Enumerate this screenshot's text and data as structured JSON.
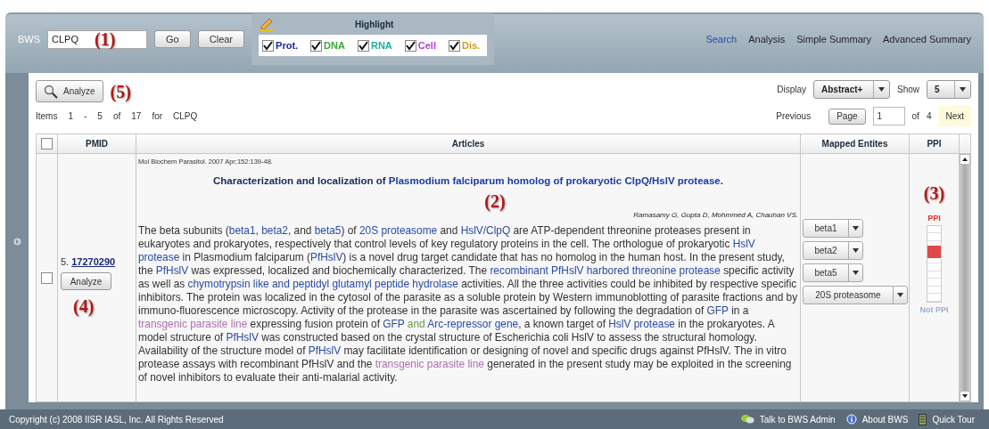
{
  "search": {
    "label": "BWS",
    "value": "CLPQ",
    "callout": "(1)",
    "go": "Go",
    "clear": "Clear"
  },
  "highlight": {
    "title": "Highlight",
    "options": [
      {
        "label": "Prot.",
        "checked": true,
        "color": "#1a2a9a"
      },
      {
        "label": "DNA",
        "checked": true,
        "color": "#3aa83a"
      },
      {
        "label": "RNA",
        "checked": true,
        "color": "#1aae9a"
      },
      {
        "label": "Cell",
        "checked": true,
        "color": "#b040e0"
      },
      {
        "label": "Dis.",
        "checked": true,
        "color": "#c8a020"
      }
    ]
  },
  "nav": [
    {
      "label": "Search",
      "selected": true
    },
    {
      "label": "Analysis",
      "selected": false
    },
    {
      "label": "Simple Summary",
      "selected": false
    },
    {
      "label": "Advanced Summary",
      "selected": false
    }
  ],
  "toolbar": {
    "analyze": "Analyze",
    "callout": "(5)",
    "display_label": "Display",
    "display_value": "Abstract+",
    "show_label": "Show",
    "show_value": "5"
  },
  "items": {
    "label": "Items",
    "from": "1",
    "dash": "-",
    "to": "5",
    "of": "of",
    "total": "17",
    "for": "for",
    "query": "CLPQ"
  },
  "pager": {
    "previous": "Previous",
    "page": "Page",
    "page_value": "1",
    "of": "of",
    "pages": "4",
    "next": "Next"
  },
  "table": {
    "select_all_checked": false,
    "columns": [
      "PMID",
      "Articles",
      "Mapped Entites",
      "PPI"
    ],
    "rows": [
      {
        "checked": false,
        "index": "5.",
        "pmid": "17270290",
        "analyze": "Analyze",
        "callout": "(4)",
        "citation": "Mol Biochem Parasitol. 2007 Apr;152:139-48.",
        "title": [
          {
            "kind": "plain",
            "text": "Characterization and localization of "
          },
          {
            "kind": "prot",
            "text": "Plasmodium falciparum homolog of prokaryotic ClpQ"
          },
          {
            "kind": "plain",
            "text": "/"
          },
          {
            "kind": "prot",
            "text": "HslV protease"
          },
          {
            "kind": "plain",
            "text": "."
          }
        ],
        "article_callout": "(2)",
        "authors": "Ramasamy G, Gupta D, Mohmmed A, Chauhan VS.",
        "abstract": [
          {
            "kind": "plain",
            "text": "The beta subunits ("
          },
          {
            "kind": "prot",
            "text": "beta1"
          },
          {
            "kind": "plain",
            "text": ", "
          },
          {
            "kind": "prot",
            "text": "beta2"
          },
          {
            "kind": "plain",
            "text": ", and "
          },
          {
            "kind": "prot",
            "text": "beta5"
          },
          {
            "kind": "plain",
            "text": ") of "
          },
          {
            "kind": "prot",
            "text": "20S proteasome"
          },
          {
            "kind": "plain",
            "text": " and "
          },
          {
            "kind": "prot",
            "text": "HslV/ClpQ"
          },
          {
            "kind": "plain",
            "text": " are ATP-dependent threonine proteases present in eukaryotes and prokaryotes, respectively that control levels of key regulatory proteins in the cell. The orthologue of prokaryotic "
          },
          {
            "kind": "prot",
            "text": "HslV protease"
          },
          {
            "kind": "plain",
            "text": " in Plasmodium falciparum ("
          },
          {
            "kind": "prot",
            "text": "PfHslV"
          },
          {
            "kind": "plain",
            "text": ") is a novel drug target candidate that has no homolog in the human host. In the present study, the "
          },
          {
            "kind": "prot",
            "text": "PfHslV"
          },
          {
            "kind": "plain",
            "text": " was expressed, localized and biochemically characterized. The "
          },
          {
            "kind": "prot",
            "text": "recombinant PfHslV harbored threonine protease"
          },
          {
            "kind": "plain",
            "text": " specific activity as well as "
          },
          {
            "kind": "prot",
            "text": "chymotrypsin like and peptidyl glutamyl peptide hydrolase"
          },
          {
            "kind": "plain",
            "text": " activities. All the three activities could be inhibited by respective specific inhibitors. The protein was localized in the cytosol of the parasite as a soluble protein by Western immunoblotting of parasite fractions and by immuno-fluorescence microscopy. Activity of the protease in the parasite was ascertained by following the degradation of "
          },
          {
            "kind": "prot",
            "text": "GFP"
          },
          {
            "kind": "plain",
            "text": " in a "
          },
          {
            "kind": "cell",
            "text": "transgenic parasite line"
          },
          {
            "kind": "plain",
            "text": " expressing fusion protein of "
          },
          {
            "kind": "prot",
            "text": "GFP"
          },
          {
            "kind": "dna",
            "text": " and "
          },
          {
            "kind": "prot",
            "text": "Arc-repressor gene"
          },
          {
            "kind": "plain",
            "text": ", a known target of "
          },
          {
            "kind": "prot",
            "text": "HslV protease"
          },
          {
            "kind": "plain",
            "text": " in the prokaryotes. A model structure of "
          },
          {
            "kind": "prot",
            "text": "PfHslV"
          },
          {
            "kind": "plain",
            "text": " was constructed based on the crystal structure of Escherichia coli HslV to assess the structural homology. Availability of the structure model of "
          },
          {
            "kind": "prot",
            "text": "PfHslV"
          },
          {
            "kind": "plain",
            "text": " may facilitate identification or designing of novel and specific drugs against PfHslV. The in vitro protease assays with recombinant PfHslV and the "
          },
          {
            "kind": "cell",
            "text": "transgenic parasite line"
          },
          {
            "kind": "plain",
            "text": " generated in the present study may be exploited in the screening of novel inhibitors to evaluate their anti-malarial activity."
          }
        ],
        "entities": [
          "beta1",
          "beta2",
          "beta5",
          "20S proteasome"
        ],
        "ppi": {
          "callout": "(3)",
          "top": "PPI",
          "bottom": "Not PPI",
          "level": 0.65
        }
      }
    ]
  },
  "footer": {
    "copyright": "Copyright (c) 2008  IISR  IASL, Inc. All Rights Reserved",
    "links": [
      "Talk to BWS Admin",
      "About BWS",
      "Quick Tour"
    ]
  }
}
